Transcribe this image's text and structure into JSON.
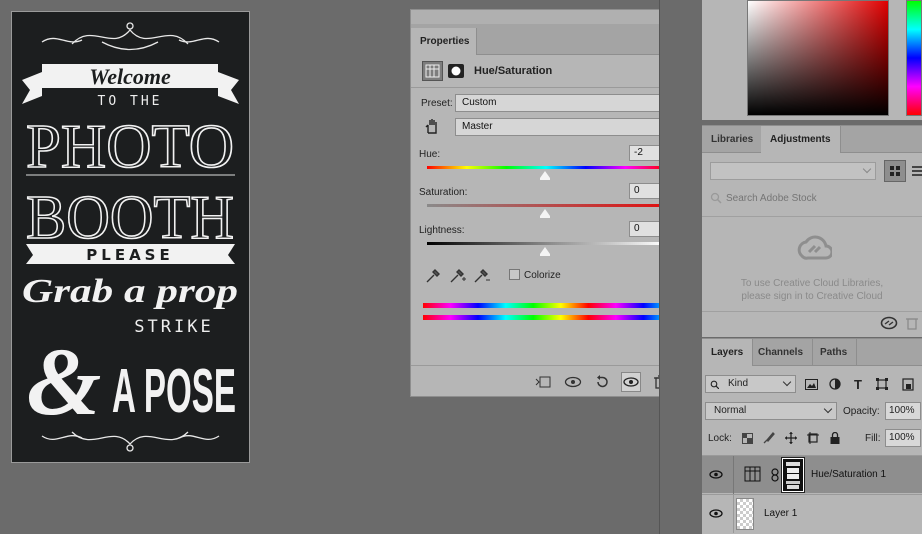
{
  "document": {
    "line_welcome": "Welcome",
    "line_tothe": "TO THE",
    "line_photo": "PHOTO",
    "line_booth": "BOOTH",
    "line_please": "PLEASE",
    "line_grab": "Grab a prop",
    "line_strike": "STRIKE",
    "line_amp": "&",
    "line_apose": "A POSE"
  },
  "properties": {
    "tab_label": "Properties",
    "adjustment_title": "Hue/Saturation",
    "preset_label": "Preset:",
    "preset_value": "Custom",
    "channel_value": "Master",
    "hue_label": "Hue:",
    "hue_value": "-2",
    "hue_level": -2,
    "saturation_label": "Saturation:",
    "saturation_value": "0",
    "lightness_label": "Lightness:",
    "lightness_value": "0",
    "colorize_label": "Colorize",
    "colorize_checked": false
  },
  "libraries": {
    "tab_libraries": "Libraries",
    "tab_adjustments": "Adjustments",
    "search_placeholder": "Search Adobe Stock",
    "signin_message_line1": "To use Creative Cloud Libraries,",
    "signin_message_line2": "please sign in to Creative Cloud"
  },
  "layers": {
    "tab_layers": "Layers",
    "tab_channels": "Channels",
    "tab_paths": "Paths",
    "filter_value": "Kind",
    "blend_mode": "Normal",
    "opacity_label": "Opacity:",
    "opacity_value": "100%",
    "lock_label": "Lock:",
    "fill_label": "Fill:",
    "fill_value": "100%",
    "items": [
      {
        "name": "Hue/Saturation 1"
      },
      {
        "name": "Layer 1"
      }
    ]
  },
  "colors": {
    "panel_bg": "#b6b6b6",
    "workspace_bg": "#6b6b6b",
    "chalkboard": "#1c1e1f",
    "selected_row": "#8e8e8e"
  }
}
